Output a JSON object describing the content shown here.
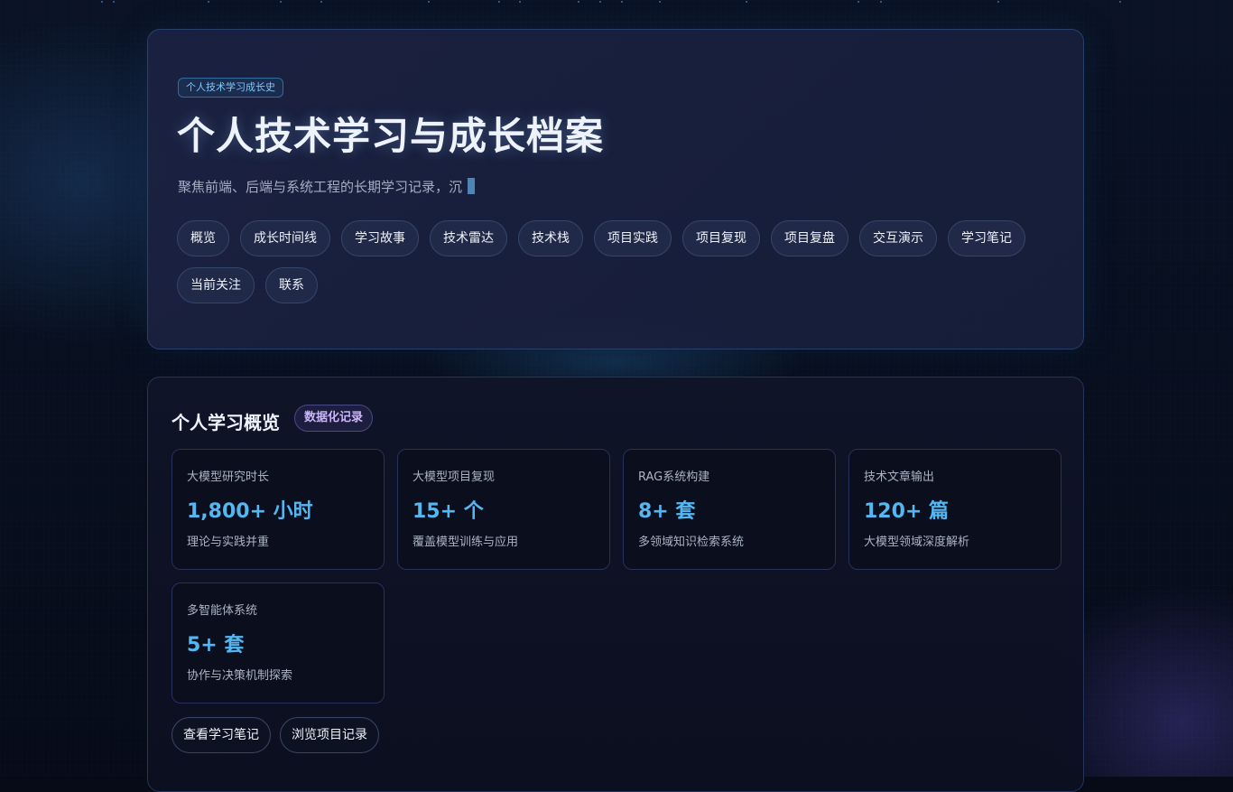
{
  "hero": {
    "badge": "个人技术学习成长史",
    "title": "个人技术学习与成长档案",
    "subtitle": "聚焦前端、后端与系统工程的长期学习记录，沉",
    "nav": [
      {
        "label": "概览"
      },
      {
        "label": "成长时间线"
      },
      {
        "label": "学习故事"
      },
      {
        "label": "技术雷达"
      },
      {
        "label": "技术栈"
      },
      {
        "label": "项目实践"
      },
      {
        "label": "项目复现"
      },
      {
        "label": "项目复盘"
      },
      {
        "label": "交互演示"
      },
      {
        "label": "学习笔记"
      },
      {
        "label": "当前关注"
      },
      {
        "label": "联系"
      }
    ]
  },
  "overview": {
    "title": "个人学习概览",
    "badge": "数据化记录",
    "stats": [
      {
        "label": "大模型研究时长",
        "value": "1,800+ 小时",
        "desc": "理论与实践并重"
      },
      {
        "label": "大模型项目复现",
        "value": "15+ 个",
        "desc": "覆盖模型训练与应用"
      },
      {
        "label": "RAG系统构建",
        "value": "8+ 套",
        "desc": "多领域知识检索系统"
      },
      {
        "label": "技术文章输出",
        "value": "120+ 篇",
        "desc": "大模型领域深度解析"
      },
      {
        "label": "多智能体系统",
        "value": "5+ 套",
        "desc": "协作与决策机制探索"
      }
    ],
    "actions": [
      {
        "label": "查看学习笔记"
      },
      {
        "label": "浏览项目记录"
      }
    ]
  },
  "colors": {
    "background": "#060b17",
    "accent": "#54b7f2",
    "badge_text": "#7fc7f7",
    "purple_badge": "#c9b6f7"
  }
}
